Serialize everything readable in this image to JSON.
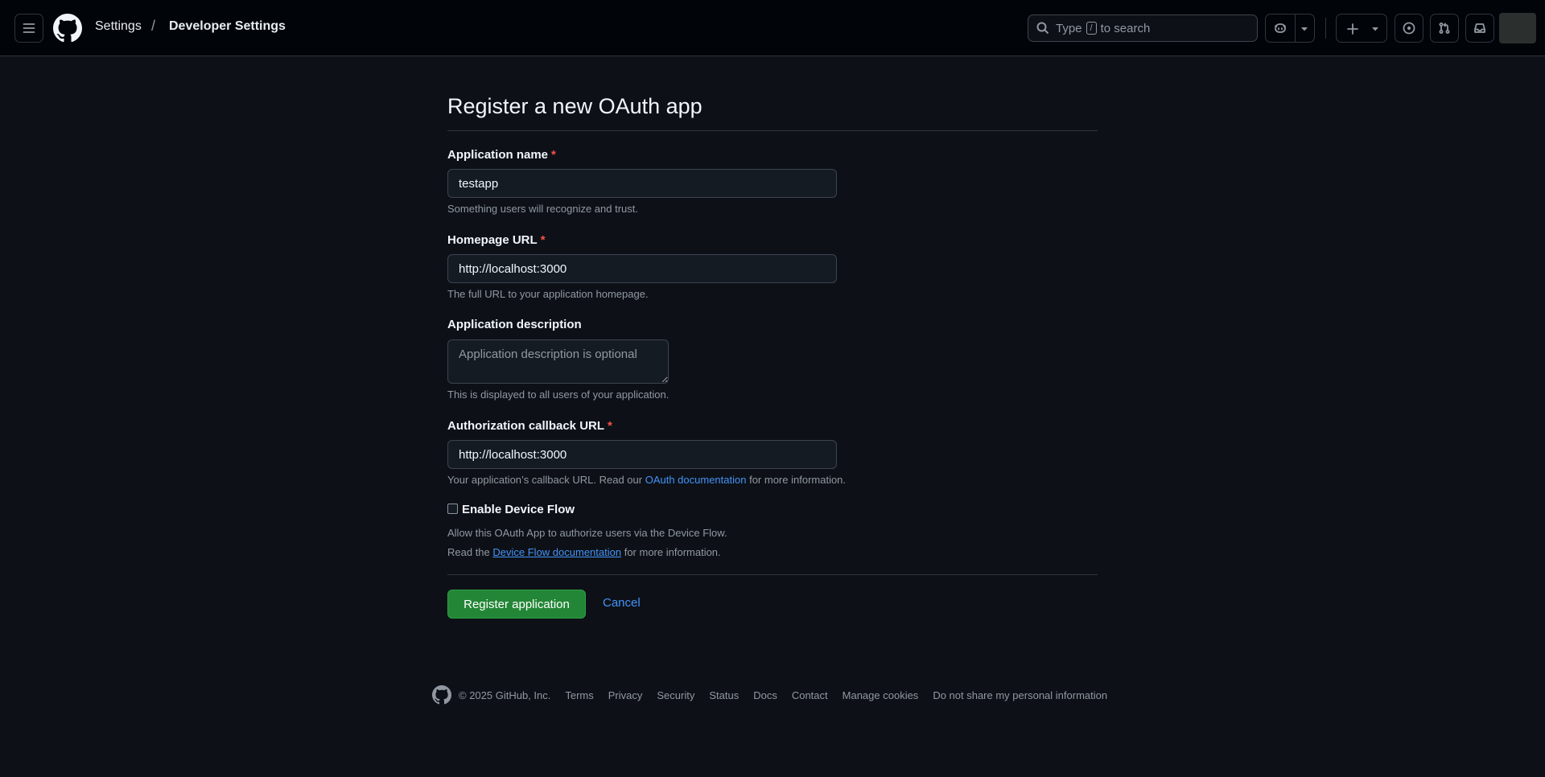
{
  "header": {
    "breadcrumb_settings": "Settings",
    "breadcrumb_separator": "/",
    "breadcrumb_current": "Developer Settings",
    "search_prefix": "Type",
    "search_key": "/",
    "search_suffix": "to search",
    "icons": [
      "menu-icon",
      "github-logo",
      "search-icon",
      "copilot-icon",
      "chevron-down-icon",
      "plus-icon",
      "issue-icon",
      "pull-request-icon",
      "inbox-icon"
    ]
  },
  "form": {
    "title": "Register a new OAuth app",
    "app_name": {
      "label": "Application name",
      "required_mark": "*",
      "value": "testapp",
      "help": "Something users will recognize and trust."
    },
    "homepage": {
      "label": "Homepage URL",
      "required_mark": "*",
      "value": "http://localhost:3000",
      "help": "The full URL to your application homepage."
    },
    "description": {
      "label": "Application description",
      "placeholder": "Application description is optional",
      "value": "",
      "help": "This is displayed to all users of your application."
    },
    "callback": {
      "label": "Authorization callback URL",
      "required_mark": "*",
      "value": "http://localhost:3000",
      "help_before": "Your application’s callback URL. Read our",
      "help_link": "OAuth documentation",
      "help_after": "for more information."
    },
    "device_flow": {
      "label": "Enable Device Flow",
      "checked": false,
      "help1": "Allow this OAuth App to authorize users via the Device Flow.",
      "help2_before": "Read the",
      "help2_link": "Device Flow documentation",
      "help2_after": "for more information."
    },
    "register_label": "Register application",
    "cancel_label": "Cancel"
  },
  "footer": {
    "copyright": "© 2025 GitHub, Inc.",
    "links": [
      "Terms",
      "Privacy",
      "Security",
      "Status",
      "Docs",
      "Contact",
      "Manage cookies",
      "Do not share my personal information"
    ]
  },
  "colors": {
    "background": "#0d1117",
    "header_bg": "#010409",
    "accent_link": "#4493f8",
    "primary_button": "#238636",
    "required": "#f85149"
  }
}
